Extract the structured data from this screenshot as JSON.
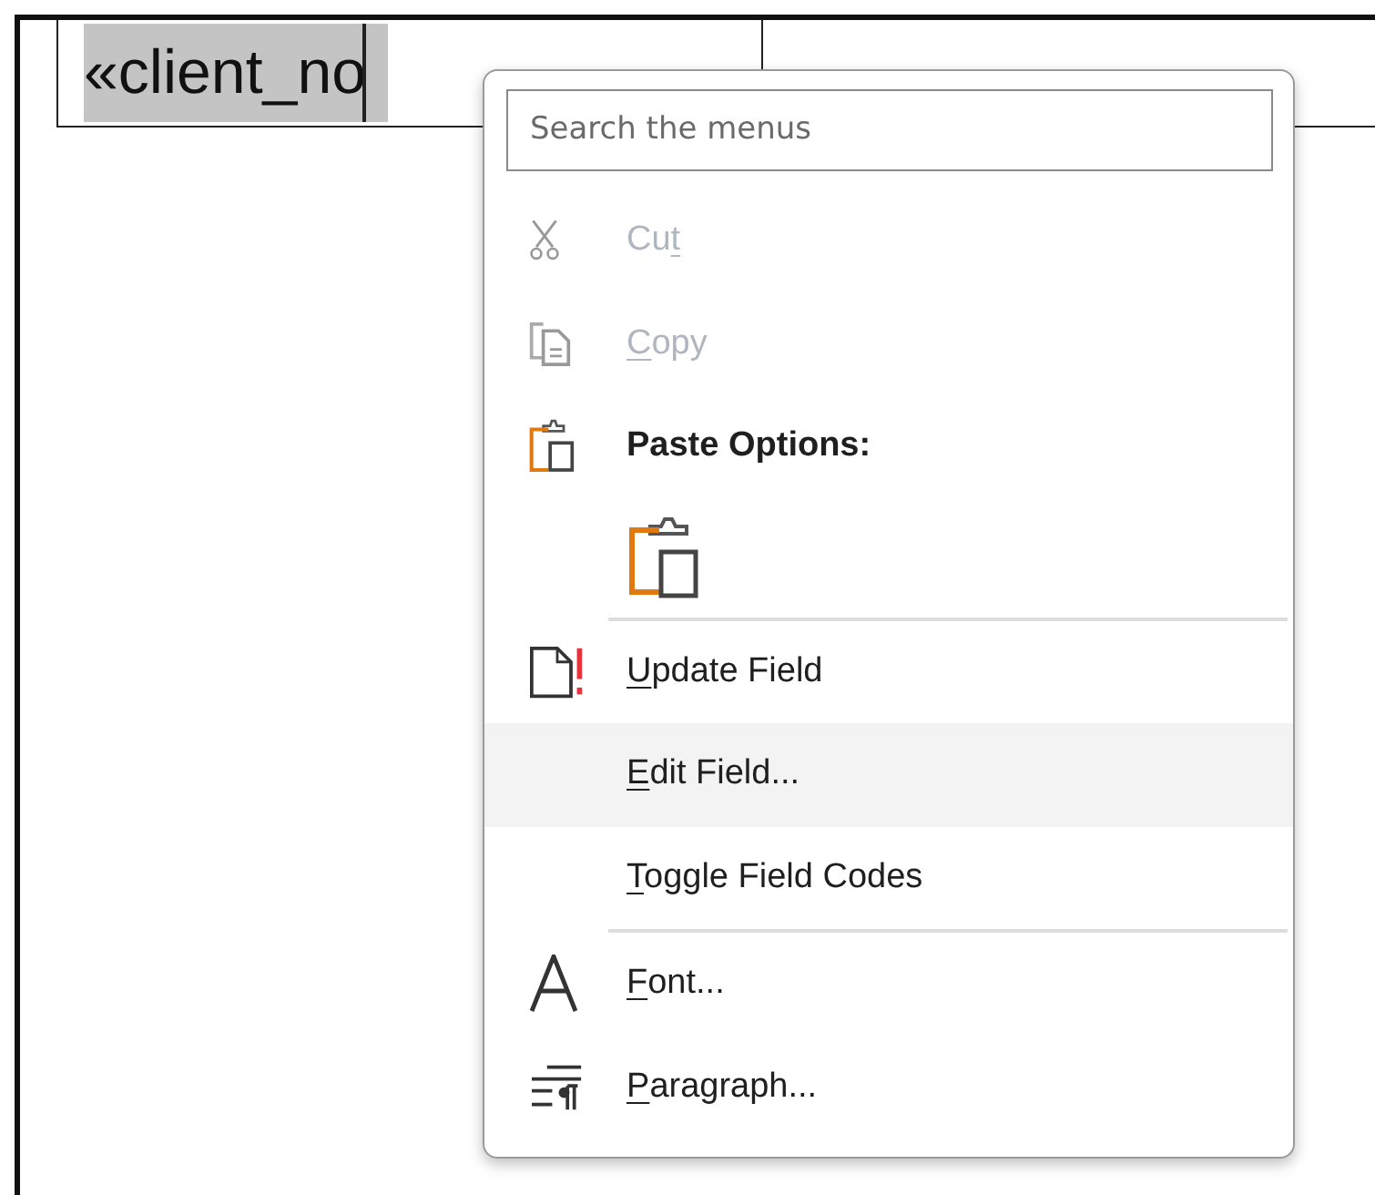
{
  "document": {
    "field_text": "«client_no"
  },
  "context_menu": {
    "search": {
      "placeholder": "Search the menus"
    },
    "items": [
      {
        "kind": "command",
        "label_before": "Cu",
        "access_key": "t",
        "disabled": true,
        "highlighted": false
      },
      {
        "kind": "command",
        "access_key": "C",
        "label_after": "opy",
        "disabled": true,
        "highlighted": false
      },
      {
        "kind": "heading",
        "label_before": "Paste Options:",
        "disabled": false,
        "highlighted": false
      },
      {
        "kind": "paste_buttons",
        "disabled": false,
        "highlighted": false
      },
      {
        "kind": "separator"
      },
      {
        "kind": "command",
        "access_key": "U",
        "label_after": "pdate Field",
        "disabled": false,
        "highlighted": false
      },
      {
        "kind": "command",
        "access_key": "E",
        "label_after": "dit Field...",
        "disabled": false,
        "highlighted": true
      },
      {
        "kind": "command",
        "access_key": "T",
        "label_after": "oggle Field Codes",
        "disabled": false,
        "highlighted": false
      },
      {
        "kind": "separator"
      },
      {
        "kind": "command",
        "access_key": "F",
        "label_after": "ont...",
        "disabled": false,
        "highlighted": false
      },
      {
        "kind": "command",
        "access_key": "P",
        "label_after": "aragraph...",
        "disabled": false,
        "highlighted": false
      }
    ]
  }
}
